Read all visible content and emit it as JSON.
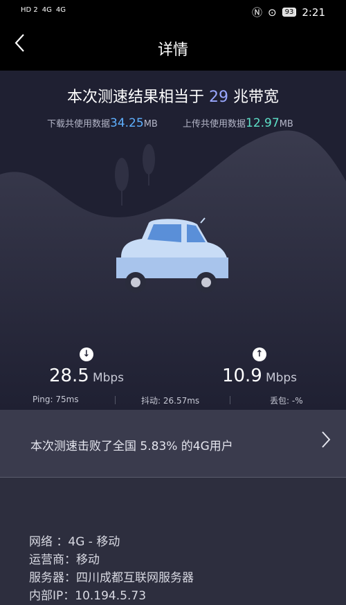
{
  "status_bar": {
    "left_icons": [
      "hd-icon",
      "signal-4g-icon",
      "signal-4g-icon"
    ],
    "left_text": [
      "HD 2",
      "4G",
      "4G"
    ],
    "battery": "93",
    "time": "2:21"
  },
  "app_bar": {
    "title": "详情"
  },
  "hero": {
    "headline_prefix": "本次测速结果相当于 ",
    "headline_value": "29",
    "headline_suffix": " 兆带宽",
    "download_usage_label": "下载共使用数据",
    "download_usage_value": "34.25",
    "download_usage_unit": "MB",
    "upload_usage_label": "上传共使用数据",
    "upload_usage_value": "12.97",
    "upload_usage_unit": "MB"
  },
  "speeds": {
    "download": {
      "value": "28.5",
      "unit": "Mbps"
    },
    "upload": {
      "value": "10.9",
      "unit": "Mbps"
    }
  },
  "stats": {
    "ping": "Ping: 75ms",
    "jitter": "抖动: 26.57ms",
    "loss": "丢包: -%"
  },
  "beat": {
    "text": "本次测速击败了全国 5.83% 的4G用户"
  },
  "info": {
    "network": "网络 ：4G - 移动",
    "carrier": "运营商：移动",
    "server": "服务器：四川成都互联网服务器",
    "internal_ip": "内部IP：10.194.5.73"
  },
  "colors": {
    "download_accent": "#5fb0ff",
    "upload_accent": "#5ee0c8",
    "headline_accent": "#9aa8ff"
  }
}
